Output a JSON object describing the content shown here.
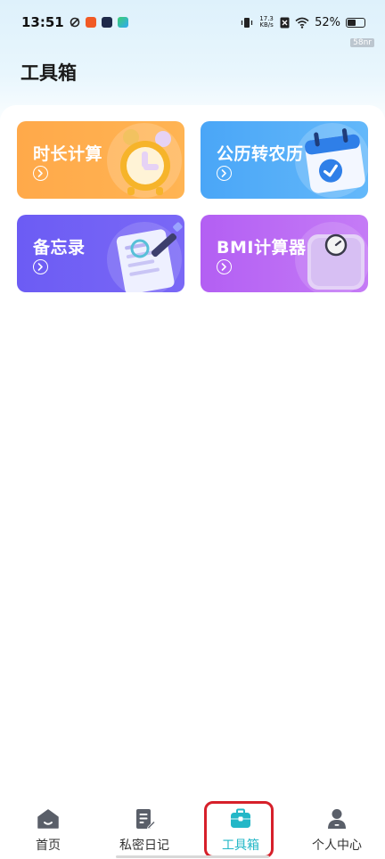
{
  "status_bar": {
    "time": "13:51",
    "net_speed_value": "17.3",
    "net_speed_unit": "KB/s",
    "battery_percent": "52%",
    "battery_level": 0.52
  },
  "watermark": "58nr",
  "page_title": "工具箱",
  "tools": [
    {
      "label": "时长计算",
      "icon": "alarm-clock-icon",
      "color": "#ffa94a"
    },
    {
      "label": "公历转农历",
      "icon": "calendar-check-icon",
      "color": "#4aa6f7"
    },
    {
      "label": "备忘录",
      "icon": "memo-pen-icon",
      "color": "#6c5cf4"
    },
    {
      "label": "BMI计算器",
      "icon": "scale-icon",
      "color": "#b35ff3"
    }
  ],
  "tabbar": {
    "items": [
      {
        "label": "首页",
        "icon": "home-icon"
      },
      {
        "label": "私密日记",
        "icon": "diary-icon"
      },
      {
        "label": "工具箱",
        "icon": "toolbox-icon"
      },
      {
        "label": "个人中心",
        "icon": "person-icon"
      }
    ],
    "active_index": 2,
    "active_color": "#23b7c7"
  }
}
